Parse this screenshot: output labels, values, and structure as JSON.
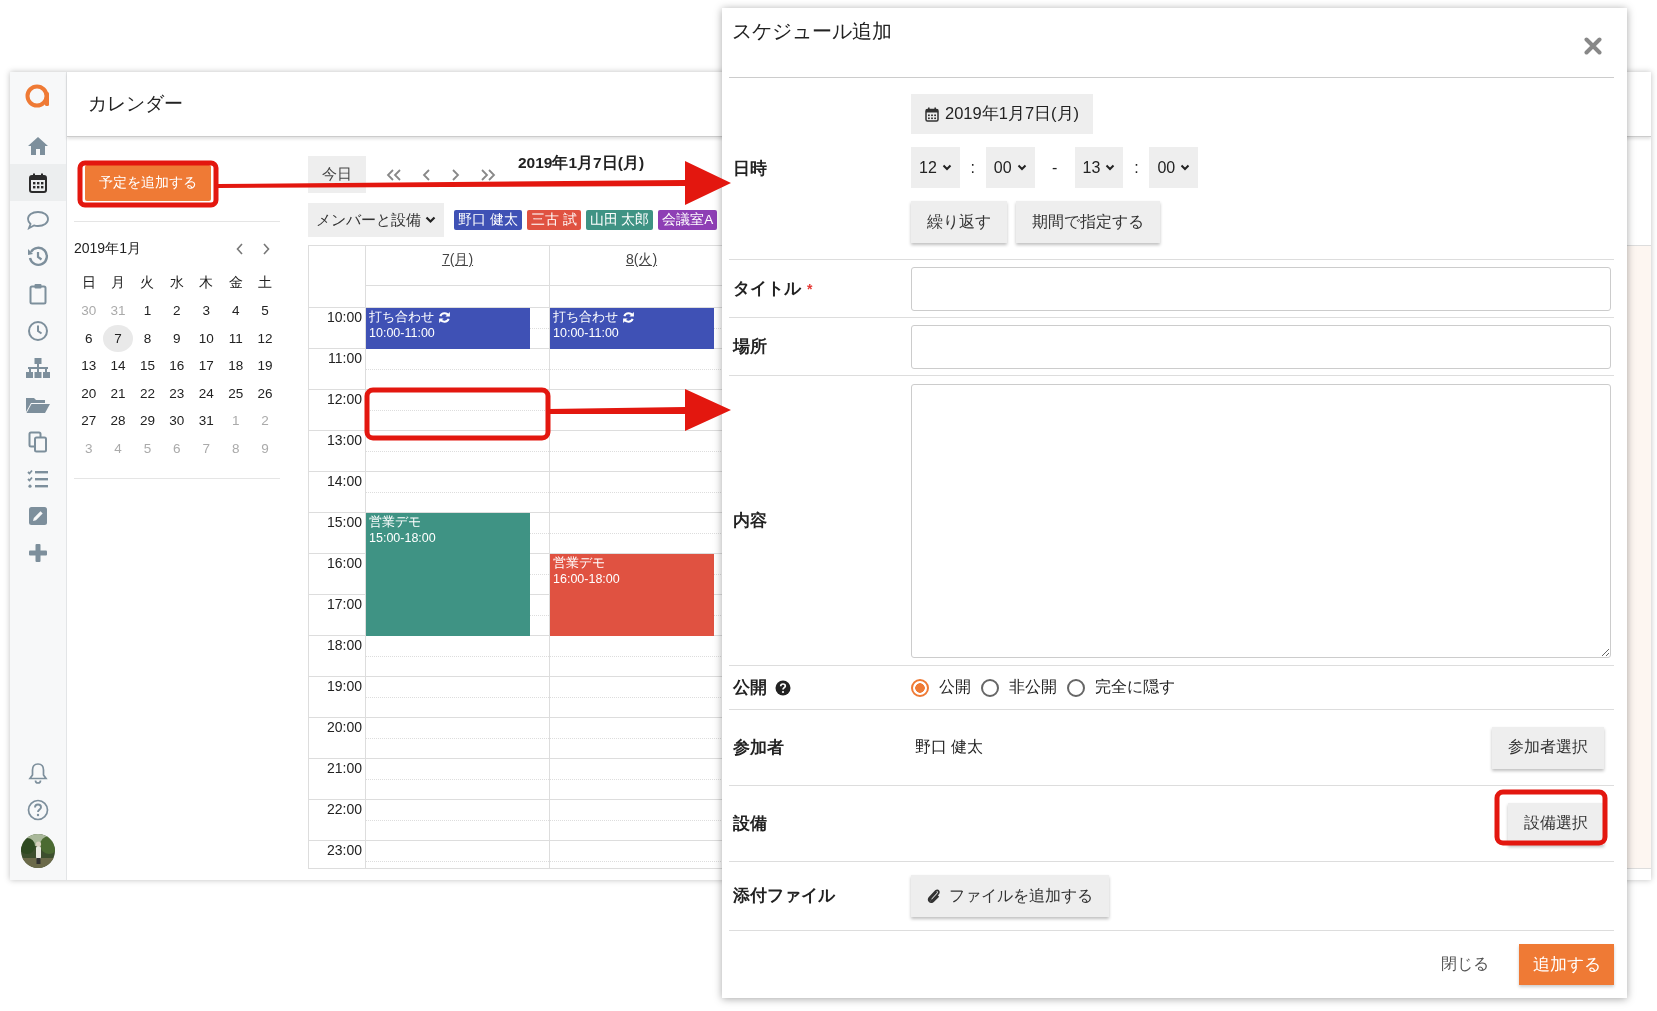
{
  "app": {
    "title": "カレンダー"
  },
  "sidebar": {
    "items": [
      {
        "kind": "home",
        "selected": false
      },
      {
        "kind": "calendar",
        "selected": true
      },
      {
        "kind": "chat",
        "selected": false
      },
      {
        "kind": "history",
        "selected": false
      },
      {
        "kind": "clipboard",
        "selected": false
      },
      {
        "kind": "clock",
        "selected": false
      },
      {
        "kind": "org",
        "selected": false
      },
      {
        "kind": "folder",
        "selected": false
      },
      {
        "kind": "copy",
        "selected": false
      },
      {
        "kind": "tasks",
        "selected": false
      },
      {
        "kind": "edit",
        "selected": false
      },
      {
        "kind": "plus",
        "selected": false
      }
    ],
    "bottom": [
      {
        "kind": "bell"
      },
      {
        "kind": "help"
      },
      {
        "kind": "avatar"
      }
    ]
  },
  "left_panel": {
    "add_button": "予定を追加する",
    "mini_calendar": {
      "month": "2019年1月",
      "weekdays": [
        "日",
        "月",
        "火",
        "水",
        "木",
        "金",
        "土"
      ],
      "weeks": [
        [
          {
            "label": "30",
            "muted": true,
            "selected": false
          },
          {
            "label": "31",
            "muted": true,
            "selected": false
          },
          {
            "label": "1",
            "muted": false,
            "selected": false
          },
          {
            "label": "2",
            "muted": false,
            "selected": false
          },
          {
            "label": "3",
            "muted": false,
            "selected": false
          },
          {
            "label": "4",
            "muted": false,
            "selected": false
          },
          {
            "label": "5",
            "muted": false,
            "selected": false
          }
        ],
        [
          {
            "label": "6",
            "muted": false,
            "selected": false
          },
          {
            "label": "7",
            "muted": false,
            "selected": true
          },
          {
            "label": "8",
            "muted": false,
            "selected": false
          },
          {
            "label": "9",
            "muted": false,
            "selected": false
          },
          {
            "label": "10",
            "muted": false,
            "selected": false
          },
          {
            "label": "11",
            "muted": false,
            "selected": false
          },
          {
            "label": "12",
            "muted": false,
            "selected": false
          }
        ],
        [
          {
            "label": "13",
            "muted": false,
            "selected": false
          },
          {
            "label": "14",
            "muted": false,
            "selected": false
          },
          {
            "label": "15",
            "muted": false,
            "selected": false
          },
          {
            "label": "16",
            "muted": false,
            "selected": false
          },
          {
            "label": "17",
            "muted": false,
            "selected": false
          },
          {
            "label": "18",
            "muted": false,
            "selected": false
          },
          {
            "label": "19",
            "muted": false,
            "selected": false
          }
        ],
        [
          {
            "label": "20",
            "muted": false,
            "selected": false
          },
          {
            "label": "21",
            "muted": false,
            "selected": false
          },
          {
            "label": "22",
            "muted": false,
            "selected": false
          },
          {
            "label": "23",
            "muted": false,
            "selected": false
          },
          {
            "label": "24",
            "muted": false,
            "selected": false
          },
          {
            "label": "25",
            "muted": false,
            "selected": false
          },
          {
            "label": "26",
            "muted": false,
            "selected": false
          }
        ],
        [
          {
            "label": "27",
            "muted": false,
            "selected": false
          },
          {
            "label": "28",
            "muted": false,
            "selected": false
          },
          {
            "label": "29",
            "muted": false,
            "selected": false
          },
          {
            "label": "30",
            "muted": false,
            "selected": false
          },
          {
            "label": "31",
            "muted": false,
            "selected": false
          },
          {
            "label": "1",
            "muted": true,
            "selected": false
          },
          {
            "label": "2",
            "muted": true,
            "selected": false
          }
        ],
        [
          {
            "label": "3",
            "muted": true,
            "selected": false
          },
          {
            "label": "4",
            "muted": true,
            "selected": false
          },
          {
            "label": "5",
            "muted": true,
            "selected": false
          },
          {
            "label": "6",
            "muted": true,
            "selected": false
          },
          {
            "label": "7",
            "muted": true,
            "selected": false
          },
          {
            "label": "8",
            "muted": true,
            "selected": false
          },
          {
            "label": "9",
            "muted": true,
            "selected": false
          }
        ]
      ]
    }
  },
  "calendar": {
    "today_button": "今日",
    "date": "2019年1月7日(月)",
    "filter": "メンバーと設備",
    "members": [
      {
        "name": "野口 健太",
        "color": "#3f51b5"
      },
      {
        "name": "三古 試",
        "color": "#e05241"
      },
      {
        "name": "山田 太郎",
        "color": "#3f9384"
      },
      {
        "name": "会議室A",
        "color": "#8e3fb5"
      }
    ],
    "hours": [
      "10:00",
      "11:00",
      "12:00",
      "13:00",
      "14:00",
      "15:00",
      "16:00",
      "17:00",
      "18:00",
      "19:00",
      "20:00",
      "21:00",
      "22:00",
      "23:00"
    ],
    "days": [
      {
        "label": "7(月)",
        "events": [
          {
            "title": "打ち合わせ",
            "time": "10:00-11:00",
            "repeat": true,
            "color": "#3f51b5"
          },
          {
            "title": "営業デモ",
            "time": "15:00-18:00",
            "repeat": false,
            "color": "#3f9384"
          }
        ]
      },
      {
        "label": "8(火)",
        "events": [
          {
            "title": "打ち合わせ",
            "time": "10:00-11:00",
            "repeat": true,
            "color": "#3f51b5"
          },
          {
            "title": "営業デモ",
            "time": "16:00-18:00",
            "repeat": false,
            "color": "#e05241"
          }
        ]
      }
    ]
  },
  "modal": {
    "title": "スケジュール追加",
    "datetime": {
      "label": "日時",
      "date": "2019年1月7日(月)",
      "start_hour": "12",
      "start_minute": "00",
      "end_hour": "13",
      "end_minute": "00",
      "time_separator": ":",
      "range_separator": "-",
      "repeat_button": "繰り返す",
      "period_button": "期間で指定する"
    },
    "title_field": {
      "label": "タイトル",
      "required_mark": "*"
    },
    "place_field": {
      "label": "場所"
    },
    "content_field": {
      "label": "内容"
    },
    "visibility": {
      "label": "公開",
      "options": [
        {
          "label": "公開",
          "selected": true
        },
        {
          "label": "非公開",
          "selected": false
        },
        {
          "label": "完全に隠す",
          "selected": false
        }
      ]
    },
    "participants": {
      "label": "参加者",
      "value": "野口 健太",
      "button": "参加者選択"
    },
    "equipment": {
      "label": "設備",
      "button": "設備選択"
    },
    "attachment": {
      "label": "添付ファイル",
      "button": "ファイルを追加する"
    },
    "footer": {
      "close": "閉じる",
      "submit": "追加する"
    }
  }
}
